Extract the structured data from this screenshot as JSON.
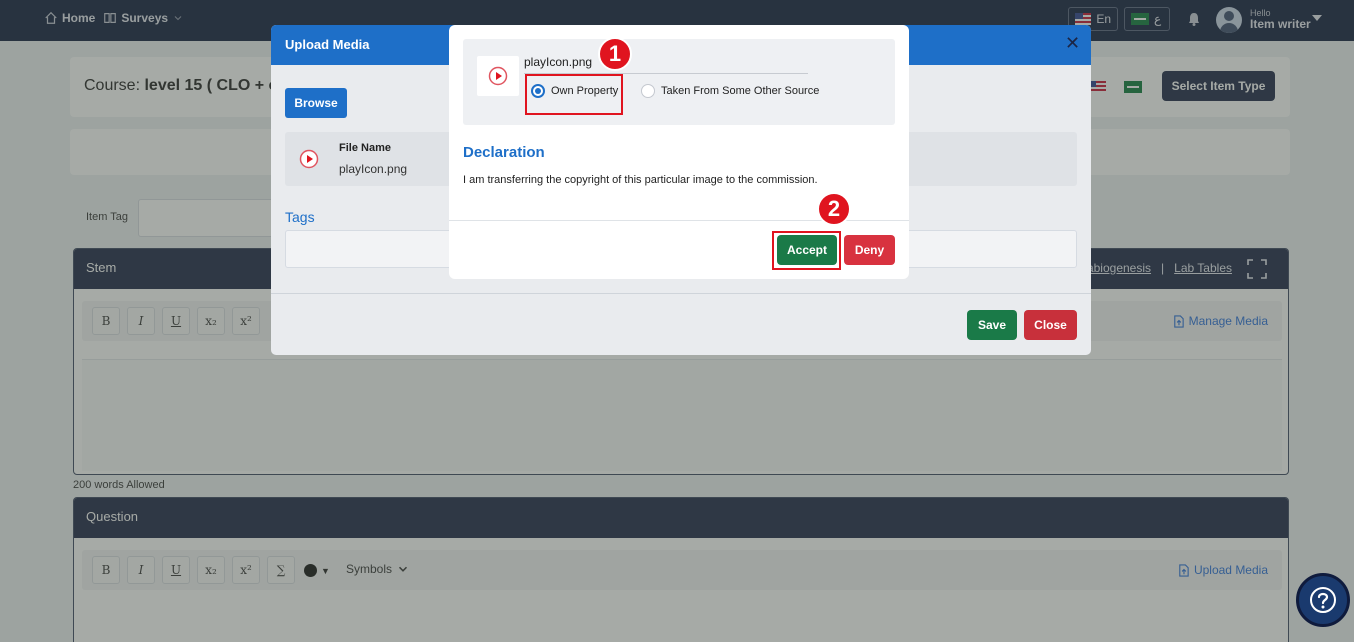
{
  "nav": {
    "home_label": "Home",
    "surveys_label": "Surveys",
    "lang_en": "En",
    "lang_ar": "ع",
    "greeting": "Hello",
    "user_name": "Item writer"
  },
  "page": {
    "course_prefix": "Course:",
    "course_name": "level 15 ( CLO + o",
    "select_item_type": "Select Item Type",
    "item_tag_label": "Item Tag",
    "stem_title": "Stem",
    "stem_link_1": "abiogenesis",
    "stem_link_sep": "|",
    "stem_link_2": "Lab Tables",
    "manage_media": "Manage Media",
    "words_allowed": "200 words Allowed",
    "question_title": "Question",
    "upload_media_link": "Upload Media",
    "symbols_label": "Symbols",
    "toolbar": [
      "B",
      "I",
      "U",
      "x₂",
      "x²"
    ],
    "sum_glyph": "∑"
  },
  "upload_modal": {
    "title": "Upload Media",
    "browse": "Browse",
    "file_name_label": "File Name",
    "file_name_value": "playIcon.png",
    "tags_label": "Tags",
    "save": "Save",
    "close": "Close"
  },
  "declaration_dialog": {
    "file_name": "playIcon.png",
    "options": [
      "Own Property",
      "Taken From Some Other Source"
    ],
    "selected_option": "Own Property",
    "title": "Declaration",
    "text": "I am transferring the copyright of this particular image to the commission.",
    "accept": "Accept",
    "deny": "Deny"
  },
  "annotations": {
    "step1": "1",
    "step2": "2"
  },
  "colors": {
    "navbar": "#0f1b3d",
    "primary": "#1e6fc8",
    "accept_green": "#1a7a48",
    "deny_red": "#d8323f",
    "highlight_red": "#e0141f"
  },
  "icons": [
    "home-icon",
    "survey-icon",
    "bell-icon",
    "play-icon",
    "close-icon",
    "expand-icon",
    "help-icon",
    "upload-icon"
  ]
}
